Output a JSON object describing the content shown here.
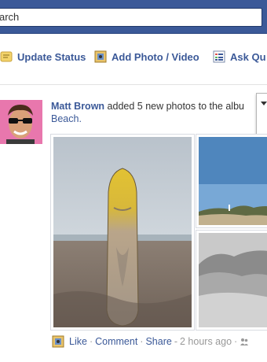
{
  "search": {
    "placeholder_visible": "arch"
  },
  "actions": [
    {
      "label": "Update Status",
      "icon": "status-note-icon"
    },
    {
      "label": "Add Photo / Video",
      "icon": "photo-icon"
    },
    {
      "label": "Ask Qu",
      "icon": "question-list-icon"
    }
  ],
  "story": {
    "actor": "Matt Brown",
    "action_text": " added 5 new photos to the albu",
    "album_tail": "Beach.",
    "footer": {
      "like": "Like",
      "comment": "Comment",
      "share": "Share",
      "time": "2 hours ago",
      "separator": "·",
      "dash": "-"
    }
  },
  "colors": {
    "brand": "#3b5998",
    "link": "#3b5998",
    "muted": "#999999"
  }
}
